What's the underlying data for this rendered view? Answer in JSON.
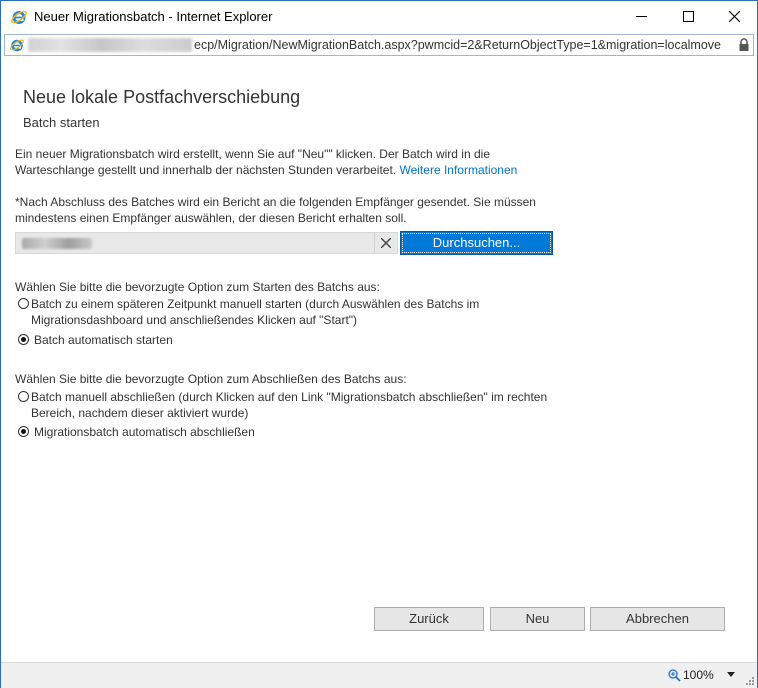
{
  "window": {
    "title": "Neuer Migrationsbatch - Internet Explorer",
    "minimize_label": "Minimize",
    "maximize_label": "Maximize",
    "close_label": "Close"
  },
  "address": {
    "path": "ecp/Migration/NewMigrationBatch.aspx?pwmcid=2&ReturnObjectType=1&migration=localmove"
  },
  "page": {
    "heading": "Neue lokale Postfachverschiebung",
    "subheading": "Batch starten",
    "intro_text": "Ein neuer Migrationsbatch wird erstellt, wenn Sie auf \"Neu\"\" klicken. Der Batch wird in die Warteschlange gestellt und innerhalb der nächsten Stunden verarbeitet.",
    "more_info_link": "Weitere Informationen",
    "report_text": "*Nach Abschluss des Batches wird ein Bericht an die folgenden Empfänger gesendet. Sie müssen mindestens einen Empfänger auswählen, der diesen Bericht erhalten soll.",
    "browse_button": "Durchsuchen...",
    "start_prompt": "Wählen Sie bitte die bevorzugte Option zum Starten des Batchs aus:",
    "start_options": [
      {
        "label": "Batch zu einem späteren Zeitpunkt manuell starten (durch Auswählen des Batchs im Migrationsdashboard und anschließendes Klicken auf \"Start\")",
        "checked": false
      },
      {
        "label": "Batch automatisch starten",
        "checked": true
      }
    ],
    "complete_prompt": "Wählen Sie bitte die bevorzugte Option zum Abschließen des Batchs aus:",
    "complete_options": [
      {
        "label": "Batch manuell abschließen (durch Klicken auf den Link \"Migrationsbatch abschließen\" im rechten Bereich, nachdem dieser aktiviert wurde)",
        "checked": false
      },
      {
        "label": "Migrationsbatch automatisch abschließen",
        "checked": true
      }
    ]
  },
  "buttons": {
    "back": "Zurück",
    "new": "Neu",
    "cancel": "Abbrechen"
  },
  "status": {
    "zoom": "100%"
  },
  "colors": {
    "accent": "#0078d7",
    "link": "#0072c6"
  }
}
